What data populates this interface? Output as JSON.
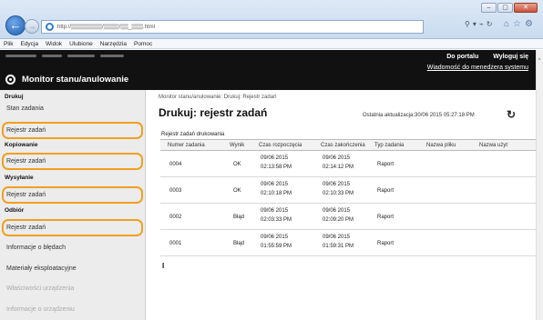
{
  "browser": {
    "url": "http://▒▒▒▒▒▒▒▒/▒▒▒▒/▒▒_▒▒▒.html",
    "window_buttons": [
      "–",
      "▢",
      "✕"
    ],
    "menu": [
      "Plik",
      "Edycja",
      "Widok",
      "Ulubione",
      "Narzędzia",
      "Pomoc"
    ]
  },
  "header": {
    "portal_link": "Do portalu",
    "logout_link": "Wyloguj się",
    "admin_message_link": "Wiadomość do menedżera systemu",
    "app_title": "Monitor stanu/anulowanie"
  },
  "sidebar": {
    "sections": [
      {
        "title": "Drukuj",
        "items": [
          "Stan zadania",
          "Rejestr zadań"
        ]
      },
      {
        "title": "Kopiowanie",
        "items": [
          "Rejestr zadań"
        ]
      },
      {
        "title": "Wysyłanie",
        "items": [
          "Rejestr zadań"
        ]
      },
      {
        "title": "Odbiór",
        "items": [
          "Rejestr zadań"
        ]
      }
    ],
    "other_items": [
      "Informacje o błędach",
      "Materiały eksploatacyjne",
      "Właściwości urządzenia",
      "Informacje o urządzeniu"
    ]
  },
  "main": {
    "breadcrumb": "Monitor stanu/anulowanie: Drukuj: Rejestr zadań",
    "title": "Drukuj: rejestr zadań",
    "last_update": "Ostatnia aktualizacja:30/06 2015 05:27:18 PM",
    "table_caption": "Rejestr zadań drukowania",
    "columns": [
      "Numer zadania",
      "Wynik",
      "Czas rozpoczęcia",
      "Czas zakończenia",
      "Typ zadania",
      "Nazwa pliku",
      "Nazwa użyt"
    ],
    "rows": [
      {
        "number": "0004",
        "result": "OK",
        "start": [
          "09/06 2015",
          "02:13:58 PM"
        ],
        "end": [
          "09/06 2015",
          "02:14:12 PM"
        ],
        "type": "Raport"
      },
      {
        "number": "0003",
        "result": "OK",
        "start": [
          "09/06 2015",
          "02:10:18 PM"
        ],
        "end": [
          "09/06 2015",
          "02:10:33 PM"
        ],
        "type": "Raport"
      },
      {
        "number": "0002",
        "result": "Błąd",
        "start": [
          "09/06 2015",
          "02:03:33 PM"
        ],
        "end": [
          "09/06 2015",
          "02:09:20 PM"
        ],
        "type": "Raport"
      },
      {
        "number": "0001",
        "result": "Błąd",
        "start": [
          "09/06 2015",
          "01:55:59 PM"
        ],
        "end": [
          "09/06 2015",
          "01:59:31 PM"
        ],
        "type": "Raport"
      }
    ]
  }
}
